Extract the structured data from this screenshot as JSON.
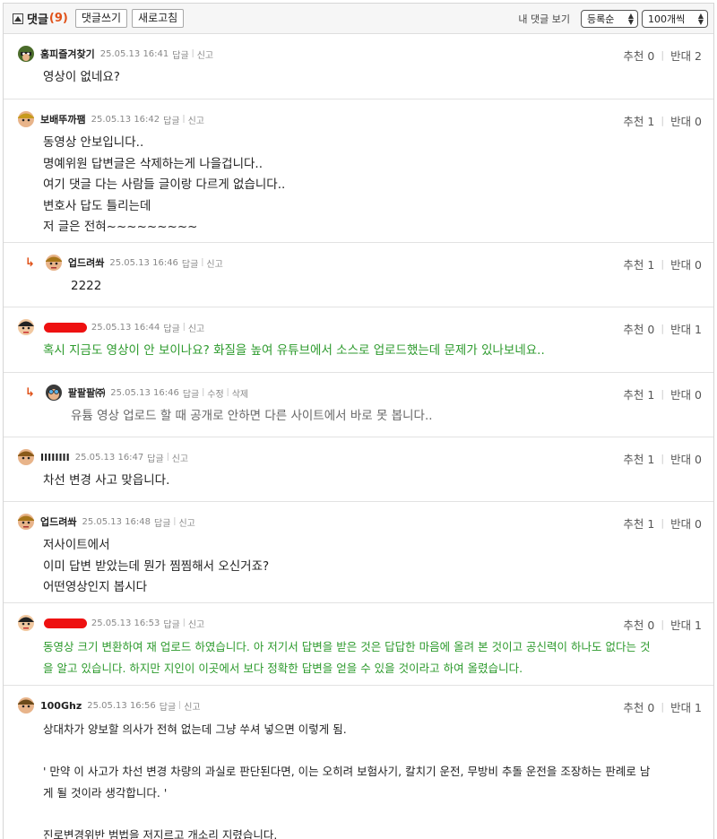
{
  "header": {
    "title": "댓글",
    "count": "(9)",
    "write_button": "댓글쓰기",
    "refresh_button": "새로고침",
    "my_comments": "내 댓글 보기",
    "sort_select": "등록순",
    "per_page_select": "100개씩"
  },
  "labels": {
    "reply": "답글",
    "report": "신고",
    "edit": "수정",
    "delete": "삭제",
    "recommend": "추천",
    "oppose": "반대"
  },
  "comments": [
    {
      "nick": "훔피즐겨찾기",
      "date": "25.05.13 16:41",
      "recommend": "추천 0",
      "oppose": "반대 2",
      "lines": [
        "영상이 없네요?"
      ]
    },
    {
      "nick": "보배뚜까팸",
      "date": "25.05.13 16:42",
      "recommend": "추천 1",
      "oppose": "반대 0",
      "lines": [
        "동영상 안보입니다..",
        "명예위원 답변글은 삭제하는게 나을겁니다..",
        "여기 댓글 다는 사람들 글이랑 다르게 없습니다..",
        "변호사 답도 틀리는데",
        "저 글은 전혀~~~~~~~~~"
      ]
    },
    {
      "nick": "업드려쏴",
      "date": "25.05.13 16:46",
      "recommend": "추천 1",
      "oppose": "반대 0",
      "lines": [
        "2222"
      ]
    },
    {
      "nick": "",
      "date": "25.05.13 16:44",
      "recommend": "추천 0",
      "oppose": "반대 1",
      "lines": [
        "혹시 지금도 영상이 안 보이나요? 화질을 높여 유튜브에서 소스로 업로드했는데 문제가 있나보네요.."
      ]
    },
    {
      "nick": "팔팔팔㈜",
      "date": "25.05.13 16:46",
      "recommend": "추천 1",
      "oppose": "반대 0",
      "lines": [
        "유튬 영상 업로드 할 때 공개로 안하면 다른 사이트에서 바로 못 봅니다.."
      ]
    },
    {
      "nick": "IIIIIIII",
      "date": "25.05.13 16:47",
      "recommend": "추천 1",
      "oppose": "반대 0",
      "lines": [
        "차선 변경 사고 맞읍니다."
      ]
    },
    {
      "nick": "업드려쏴",
      "date": "25.05.13 16:48",
      "recommend": "추천 1",
      "oppose": "반대 0",
      "lines": [
        "저사이트에서",
        "이미 답변 받았는데 뭔가 찜찜해서 오신거죠?",
        "어떤영상인지 봅시다"
      ]
    },
    {
      "nick": "",
      "date": "25.05.13 16:53",
      "recommend": "추천 0",
      "oppose": "반대 1",
      "lines": [
        "동영상 크기 변환하여 재 업로드 하였습니다. 아 저기서 답변을 받은 것은 답답한 마음에 올려 본 것이고 공신력이 하나도 없다는 것",
        "을 알고 있습니다. 하지만 지인이 이곳에서 보다 정확한 답변을 얻을 수 있을 것이라고 하여 올렸습니다."
      ]
    },
    {
      "nick": "100Ghz",
      "date": "25.05.13 16:56",
      "recommend": "추천 0",
      "oppose": "반대 1",
      "lines": [
        "상대차가 양보할 의사가 전혀 없는데 그냥 쑤셔 넣으면 이렇게 됨.",
        "",
        "' 만약 이 사고가 차선 변경 차량의 과실로 판단된다면, 이는 오히려 보험사기, 칼치기 운전, 무방비 추돌 운전을 조장하는 판례로 남",
        "게 될 것이라 생각합니다. '",
        "",
        "진로변경위반 범법을 저지르고 개소리 지렸습니다."
      ]
    }
  ],
  "colors": {
    "accent": "#e0521a",
    "author_text": "#2c9a2c",
    "redaction": "#ee1111"
  }
}
